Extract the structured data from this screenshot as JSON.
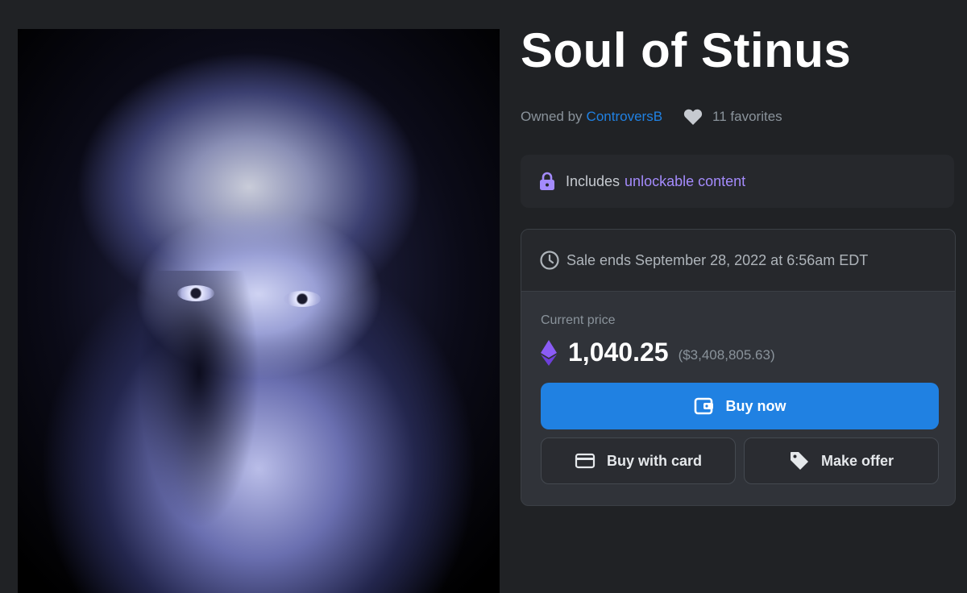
{
  "item": {
    "title": "Soul of Stinus",
    "owned_by_label": "Owned by",
    "owner": "ControversB",
    "favorites": "11 favorites"
  },
  "unlockable": {
    "prefix": "Includes",
    "link": "unlockable content"
  },
  "sale": {
    "ends_text": "Sale ends September 28, 2022 at 6:56am EDT",
    "current_price_label": "Current price",
    "price": "1,040.25",
    "price_usd": "($3,408,805.63)"
  },
  "buttons": {
    "buy_now": "Buy now",
    "buy_with_card": "Buy with card",
    "make_offer": "Make offer"
  },
  "icons": {
    "favorite": "heart-icon",
    "lock": "lock-icon",
    "clock": "clock-icon",
    "currency": "ethereum-icon",
    "wallet": "wallet-icon",
    "card": "credit-card-icon",
    "tag": "tag-icon"
  },
  "colors": {
    "accent_blue": "#2081e2",
    "accent_purple": "#a48bfc",
    "background": "#202225"
  }
}
